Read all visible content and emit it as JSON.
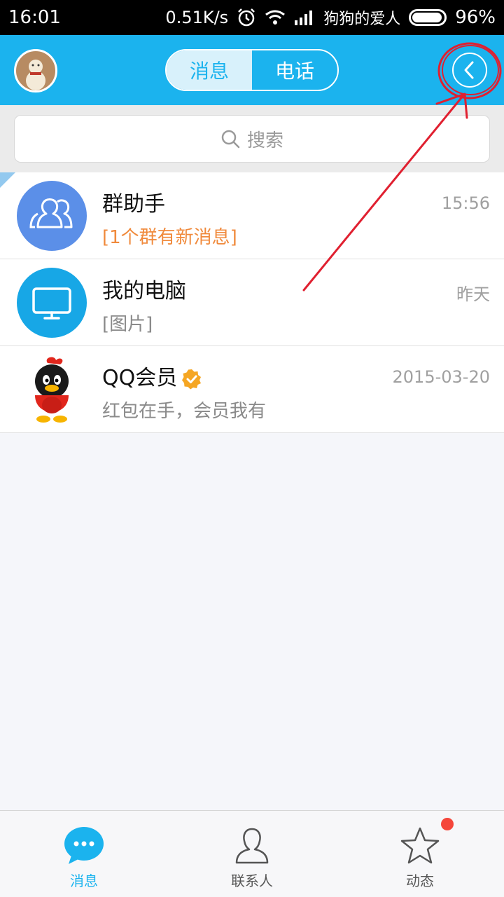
{
  "status_bar": {
    "time": "16:01",
    "net_speed": "0.51K/s",
    "carrier": "狗狗的爱人",
    "battery": "96%",
    "battery_level": 0.96
  },
  "header": {
    "tabs": [
      {
        "label": "消息",
        "active": true
      },
      {
        "label": "电话",
        "active": false
      }
    ]
  },
  "search": {
    "placeholder": "搜索"
  },
  "conversations": [
    {
      "title": "群助手",
      "preview": "[1个群有新消息]",
      "time": "15:56",
      "icon": "group-icon"
    },
    {
      "title": "我的电脑",
      "preview": "[图片]",
      "time": "昨天",
      "icon": "monitor-icon"
    },
    {
      "title": "QQ会员",
      "preview": "红包在手，会员我有",
      "time": "2015-03-20",
      "icon": "qq-penguin-icon"
    }
  ],
  "tabbar": {
    "items": [
      {
        "label": "消息",
        "icon": "chat-bubble-icon",
        "active": true
      },
      {
        "label": "联系人",
        "icon": "person-icon",
        "active": false
      },
      {
        "label": "动态",
        "icon": "star-icon",
        "active": false,
        "badge": true
      }
    ]
  },
  "colors": {
    "brand_blue": "#1bb3ee",
    "alert_orange": "#f08a3c",
    "badge_red": "#f5463a",
    "annotation_red": "#e02030"
  }
}
